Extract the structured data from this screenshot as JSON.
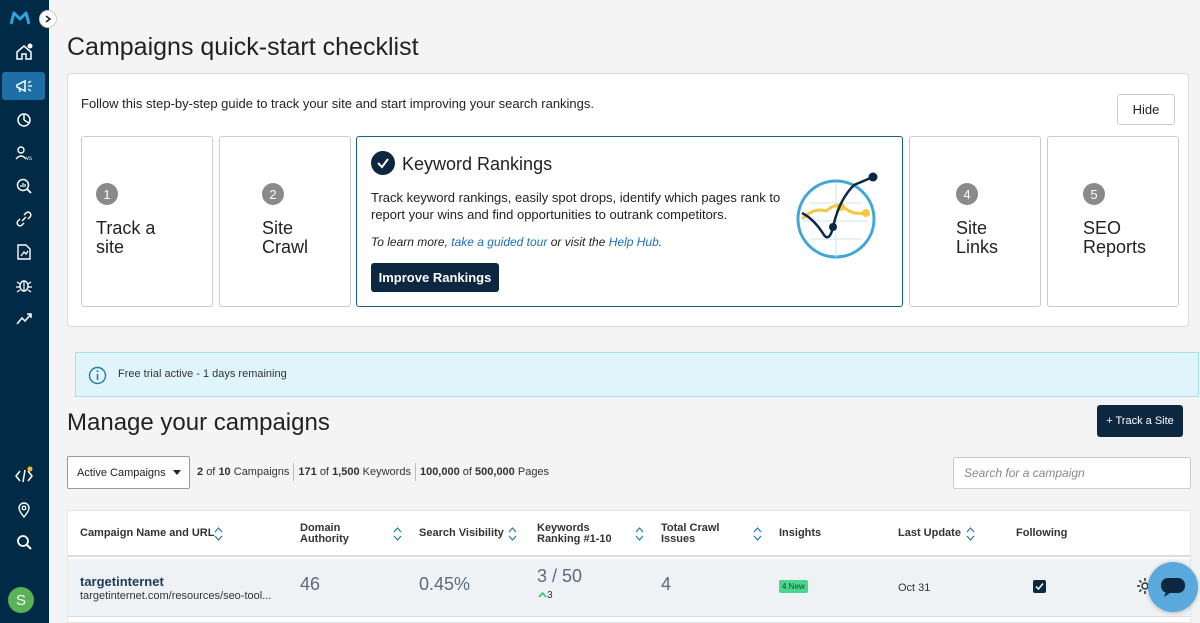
{
  "sidebar": {
    "logo": "M",
    "user_initial": "S",
    "items": [
      {
        "icon": "home-icon",
        "active": false
      },
      {
        "icon": "megaphone-icon",
        "active": true
      },
      {
        "icon": "pie-chart-icon",
        "active": false
      },
      {
        "icon": "users-vs-icon",
        "active": false
      },
      {
        "icon": "search-analytics-icon",
        "active": false
      },
      {
        "icon": "link-icon",
        "active": false
      },
      {
        "icon": "page-chart-icon",
        "active": false
      },
      {
        "icon": "bug-icon",
        "active": false
      },
      {
        "icon": "trend-icon",
        "active": false
      },
      {
        "icon": "code-icon",
        "active": false
      },
      {
        "icon": "location-icon",
        "active": false
      },
      {
        "icon": "search-icon",
        "active": false
      }
    ],
    "vs_label": "vs"
  },
  "page_title": "Campaigns quick-start checklist",
  "checklist": {
    "intro": "Follow this step-by-step guide to track your site and start improving your search rankings.",
    "hide_label": "Hide",
    "steps": [
      {
        "num": "1",
        "line1": "Track a",
        "line2": "site"
      },
      {
        "num": "2",
        "line1": "Site",
        "line2": "Crawl"
      },
      {
        "num": "4",
        "line1": "Site",
        "line2": "Links"
      },
      {
        "num": "5",
        "line1": "SEO",
        "line2": "Reports"
      }
    ],
    "active": {
      "title": "Keyword Rankings",
      "description": "Track keyword rankings, easily spot drops, identify which pages rank to report your wins and find opportunities to outrank competitors.",
      "learn_prefix": "To learn more,",
      "learn_link1": "take a guided tour",
      "learn_middle": "or visit the",
      "learn_link2": "Help Hub",
      "learn_suffix": ".",
      "button": "Improve Rankings"
    }
  },
  "trial": {
    "text": "Free trial active - 1 days remaining"
  },
  "manage": {
    "title": "Manage your campaigns",
    "track_button": "+ Track a Site",
    "filter_value": "Active Campaigns",
    "stats": {
      "campaigns_used": "2",
      "campaigns_of": "of",
      "campaigns_total": "10",
      "campaigns_label": "Campaigns",
      "keywords_used": "171",
      "keywords_of": "of",
      "keywords_total": "1,500",
      "keywords_label": "Keywords",
      "pages_used": "100,000",
      "pages_of": "of",
      "pages_total": "500,000",
      "pages_label": "Pages"
    },
    "search_placeholder": "Search for a campaign"
  },
  "table": {
    "headers": {
      "name": "Campaign Name and URL",
      "da_1": "Domain",
      "da_2": "Authority",
      "visibility": "Search Visibility",
      "kw_1": "Keywords",
      "kw_2": "Ranking #1-10",
      "crawl_1": "Total Crawl",
      "crawl_2": "Issues",
      "insights": "Insights",
      "update": "Last Update",
      "following": "Following"
    },
    "rows": [
      {
        "name": "targetinternet",
        "url": "targetinternet.com/resources/seo-tool...",
        "domain_authority": "46",
        "search_visibility": "0.45%",
        "keywords_ranking": "3 / 50",
        "keywords_change": "3",
        "crawl_issues": "4",
        "insights_badge": "4 New",
        "last_update": "Oct 31",
        "following": true
      }
    ]
  }
}
